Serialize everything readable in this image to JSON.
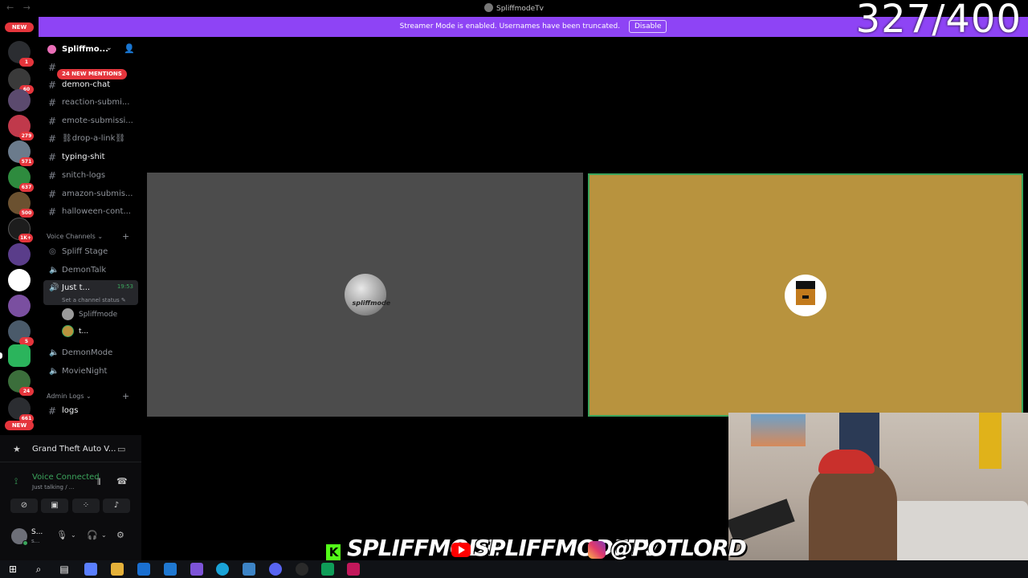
{
  "window": {
    "title": "SpliffmodeTv",
    "nav_arrows": "← →"
  },
  "banner": {
    "text": "Streamer Mode is enabled. Usernames have been truncated.",
    "disable_label": "Disable"
  },
  "counter": "327/400",
  "rail": {
    "new_top": "NEW",
    "new_bottom": "NEW",
    "badges": [
      "1",
      "60",
      "279",
      "571",
      "637",
      "500",
      "1K+",
      "5",
      "24",
      "661"
    ]
  },
  "server": {
    "name": "Spliffmo...",
    "mentions_pill": "24 NEW MENTIONS"
  },
  "channels": [
    {
      "name": "demon-chat",
      "unread": true
    },
    {
      "name": "reaction-submi...",
      "unread": false
    },
    {
      "name": "emote-submissi...",
      "unread": false
    },
    {
      "name": "⛓drop-a-link⛓",
      "unread": false
    },
    {
      "name": "typing-shit",
      "unread": true
    },
    {
      "name": "snitch-logs",
      "unread": false
    },
    {
      "name": "amazon-submis...",
      "unread": false
    },
    {
      "name": "halloween-cont...",
      "unread": false
    }
  ],
  "voice_category": "Voice Channels",
  "voice_channels": {
    "stage": "Spliff Stage",
    "talk": "DemonTalk",
    "active": "Just t...",
    "active_timer": "19:53",
    "status_hint": "Set a channel status",
    "user1": "Spliffmode",
    "user2": "t...",
    "mode": "DemonMode",
    "movie": "MovieNight"
  },
  "admin_category": "Admin Logs",
  "admin_channel": "logs",
  "activity": {
    "game": "Grand Theft Auto V..."
  },
  "voice_connection": {
    "title": "Voice Connected",
    "subtitle": "Just talking / ..."
  },
  "user": {
    "name": "S...",
    "sub": "s..."
  },
  "tiles": {
    "left_tag": "spliffmode"
  },
  "social": {
    "kick": "SPLIFFMODE",
    "youtube": "SPLIFFMODETV",
    "instagram": "@POTLORD"
  },
  "colors": {
    "banner": "#8e44f5",
    "speaking": "#3ba55c",
    "right_tile": "#b8933e",
    "left_tile": "#4c4c4c"
  }
}
